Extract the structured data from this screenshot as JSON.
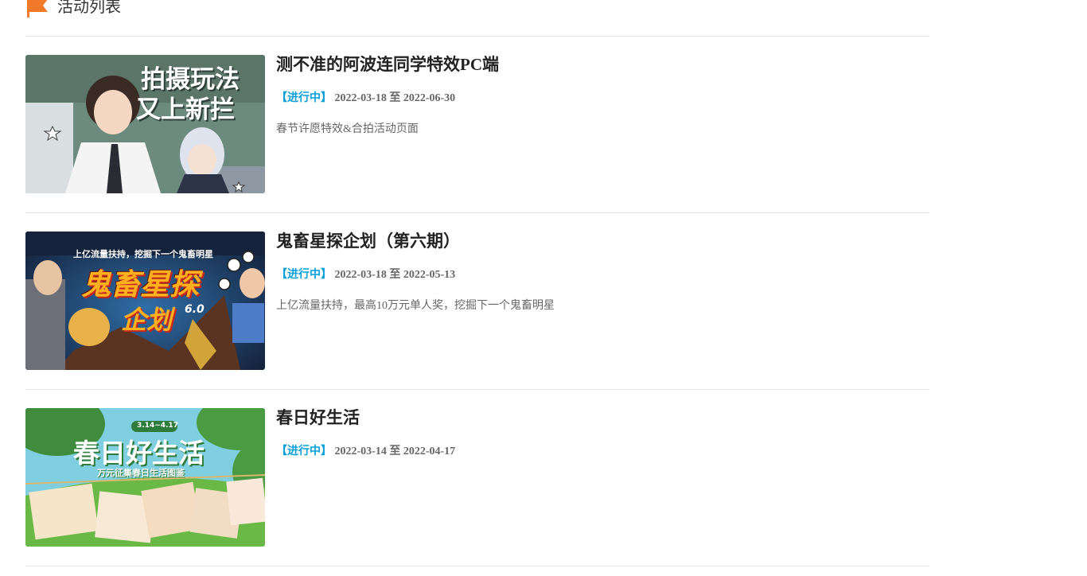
{
  "header": {
    "title": "活动列表"
  },
  "activities": [
    {
      "title": "测不准的阿波连同学特效PC端",
      "status": "【进行中】",
      "start": "2022-03-18",
      "sep": "至",
      "end": "2022-06-30",
      "desc": "春节许愿特效&合拍活动页面",
      "banner": {
        "line1": "拍摄玩法",
        "line2": "又上新拦"
      }
    },
    {
      "title": "鬼畜星探企划（第六期）",
      "status": "【进行中】",
      "start": "2022-03-18",
      "sep": "至",
      "end": "2022-05-13",
      "desc": "上亿流量扶持，最高10万元单人奖，挖掘下一个鬼畜明星",
      "banner": {
        "top": "上亿流量扶持，挖掘下一个鬼畜明星",
        "main": "鬼畜星探",
        "sub": "企划",
        "ver": "6.0"
      }
    },
    {
      "title": "春日好生活",
      "status": "【进行中】",
      "start": "2022-03-14",
      "sep": "至",
      "end": "2022-04-17",
      "desc": "",
      "banner": {
        "date": "3.14~4.17",
        "main": "春日好生活",
        "sub": "万元征集春日生活图鉴"
      }
    }
  ],
  "colors": {
    "status": "#0a9fd8",
    "flag": "#f07a2a",
    "divider": "#e5e5e5"
  }
}
